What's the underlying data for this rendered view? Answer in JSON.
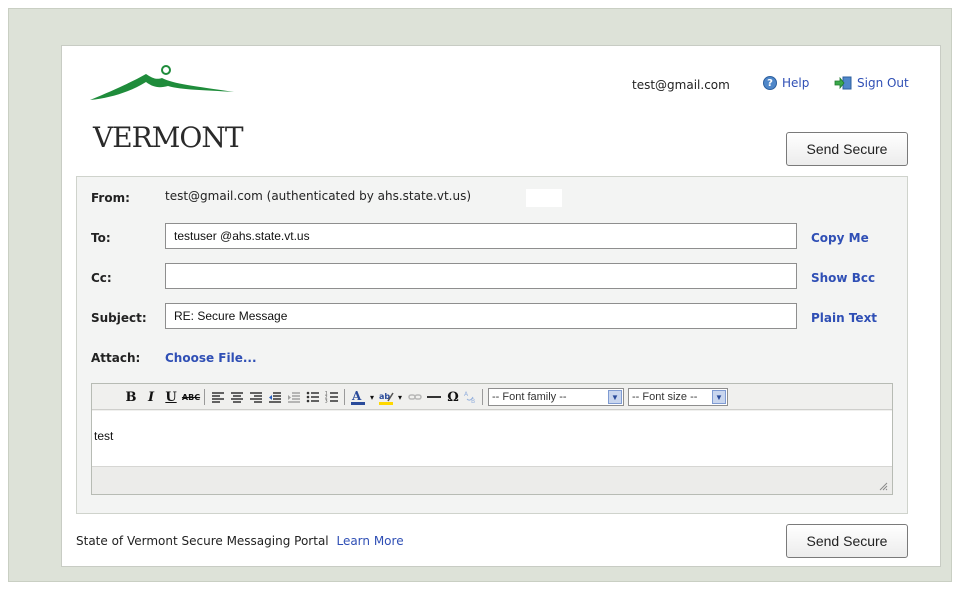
{
  "header": {
    "logo_text": "VERMONT",
    "user_email": "test@gmail.com",
    "help_label": "Help",
    "signout_label": "Sign Out",
    "send_label": "Send Secure"
  },
  "form": {
    "from_label": "From:",
    "from_value": "test@gmail.com (authenticated by ahs.state.vt.us)",
    "to_label": "To:",
    "to_value": "testuser @ahs.state.vt.us",
    "copy_me_label": "Copy Me",
    "cc_label": "Cc:",
    "cc_value": "",
    "show_bcc_label": "Show Bcc",
    "subject_label": "Subject:",
    "subject_value": "RE: Secure Message",
    "plain_text_label": "Plain Text",
    "attach_label": "Attach:",
    "choose_file_label": "Choose File..."
  },
  "editor": {
    "toolbar": {
      "bold": "B",
      "italic": "I",
      "underline": "U",
      "strike": "ABC",
      "omega": "Ω",
      "font_family": "-- Font family --",
      "font_size": "-- Font size --"
    },
    "body_text": "test"
  },
  "footer": {
    "text": "State of Vermont Secure Messaging Portal",
    "learn_more": "Learn More",
    "send_label": "Send Secure"
  },
  "colors": {
    "link": "#2f4fb5",
    "page_bg": "#dde2d8",
    "logo_green": "#1f8c3b"
  }
}
